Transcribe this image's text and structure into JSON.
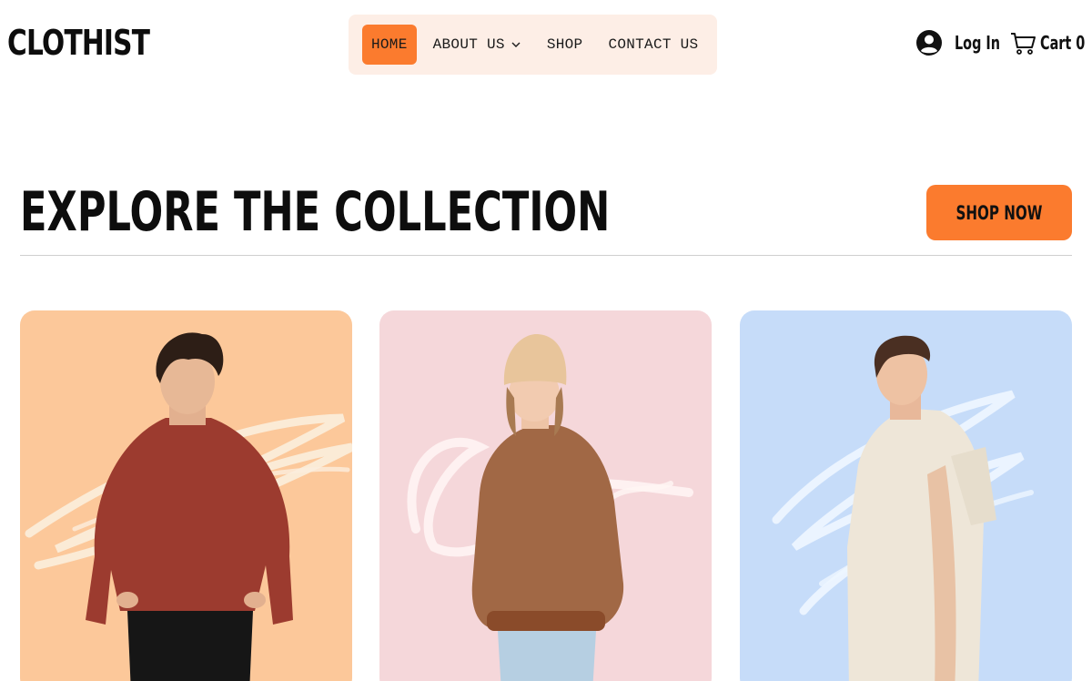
{
  "brand": {
    "name": "CLOTHIST"
  },
  "nav": {
    "items": [
      {
        "label": "HOME",
        "active": true
      },
      {
        "label": "ABOUT US",
        "has_dropdown": true
      },
      {
        "label": "SHOP"
      },
      {
        "label": "CONTACT US"
      }
    ]
  },
  "header": {
    "login_label": "Log In",
    "cart_label": "Cart",
    "cart_count": "0",
    "login_icon": "account-icon",
    "cart_icon": "cart-icon"
  },
  "collection": {
    "title": "EXPLORE THE COLLECTION",
    "shop_now_label": "SHOP NOW"
  },
  "products": [
    {
      "image": "man-red-sweater-photo",
      "background": "#fcc89a"
    },
    {
      "image": "woman-brown-sweater-beanie-photo",
      "background": "#f5d7da"
    },
    {
      "image": "man-cream-shirt-photo",
      "background": "#c6dcf9"
    }
  ],
  "colors": {
    "accent": "#fb7b2e",
    "nav_background": "#fdeee6",
    "text": "#0d0d0d"
  }
}
